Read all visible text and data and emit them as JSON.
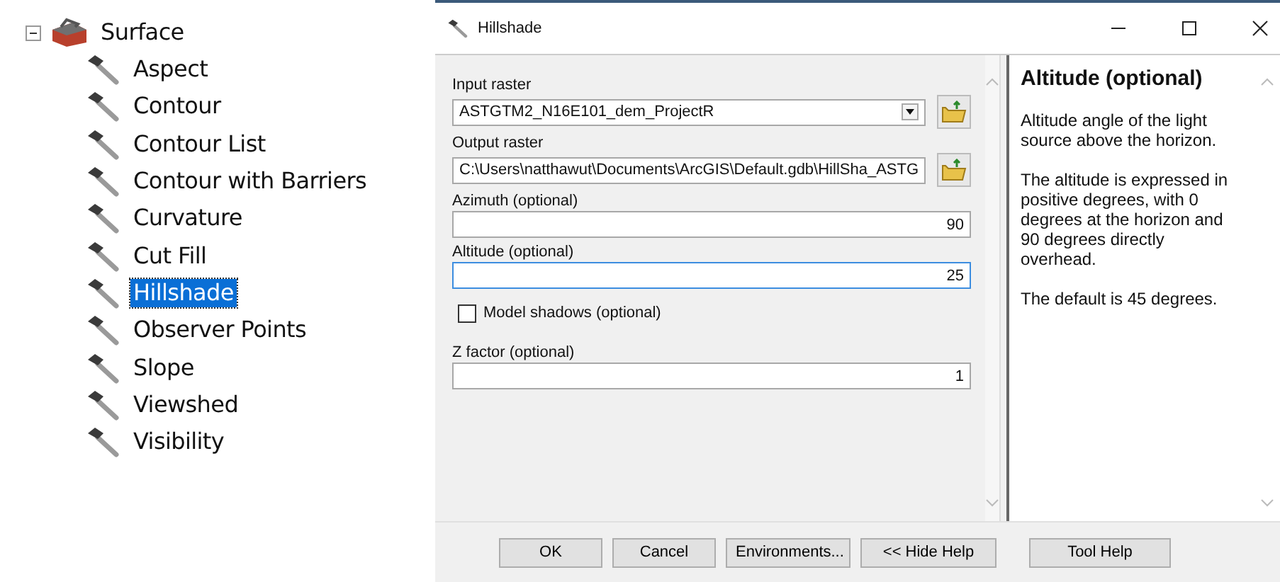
{
  "tree": {
    "label": "Surface",
    "expanded": true,
    "children": [
      {
        "label": "Aspect",
        "selected": false
      },
      {
        "label": "Contour",
        "selected": false
      },
      {
        "label": "Contour List",
        "selected": false
      },
      {
        "label": "Contour with Barriers",
        "selected": false
      },
      {
        "label": "Curvature",
        "selected": false
      },
      {
        "label": "Cut Fill",
        "selected": false
      },
      {
        "label": "Hillshade",
        "selected": true
      },
      {
        "label": "Observer Points",
        "selected": false
      },
      {
        "label": "Slope",
        "selected": false
      },
      {
        "label": "Viewshed",
        "selected": false
      },
      {
        "label": "Visibility",
        "selected": false
      }
    ]
  },
  "window": {
    "title": "Hillshade"
  },
  "form": [
    {
      "kind": "dropdown",
      "label": "Input raster",
      "value": "ASTGTM2_N16E101_dem_ProjectR",
      "browse": true,
      "focused": false
    },
    {
      "kind": "text",
      "label": "Output raster",
      "value": "C:\\Users\\natthawut\\Documents\\ArcGIS\\Default.gdb\\HillSha_ASTG",
      "browse": true,
      "focused": false
    },
    {
      "kind": "number",
      "label": "Azimuth (optional)",
      "value": "90",
      "browse": false,
      "focused": false
    },
    {
      "kind": "number",
      "label": "Altitude (optional)",
      "value": "25",
      "browse": false,
      "focused": true
    },
    {
      "kind": "checkbox",
      "label": "Model shadows (optional)",
      "checked": false
    },
    {
      "kind": "number",
      "label": "Z factor (optional)",
      "value": "1",
      "browse": false,
      "focused": false
    }
  ],
  "help": {
    "title": "Altitude (optional)",
    "paragraphs": [
      "Altitude angle of the light source above the horizon.",
      "The altitude is expressed in positive degrees, with 0 degrees at the horizon and 90 degrees directly overhead.",
      "The default is 45 degrees."
    ]
  },
  "buttons": [
    "OK",
    "Cancel",
    "Environments...",
    "<< Hide Help",
    "Tool Help"
  ]
}
